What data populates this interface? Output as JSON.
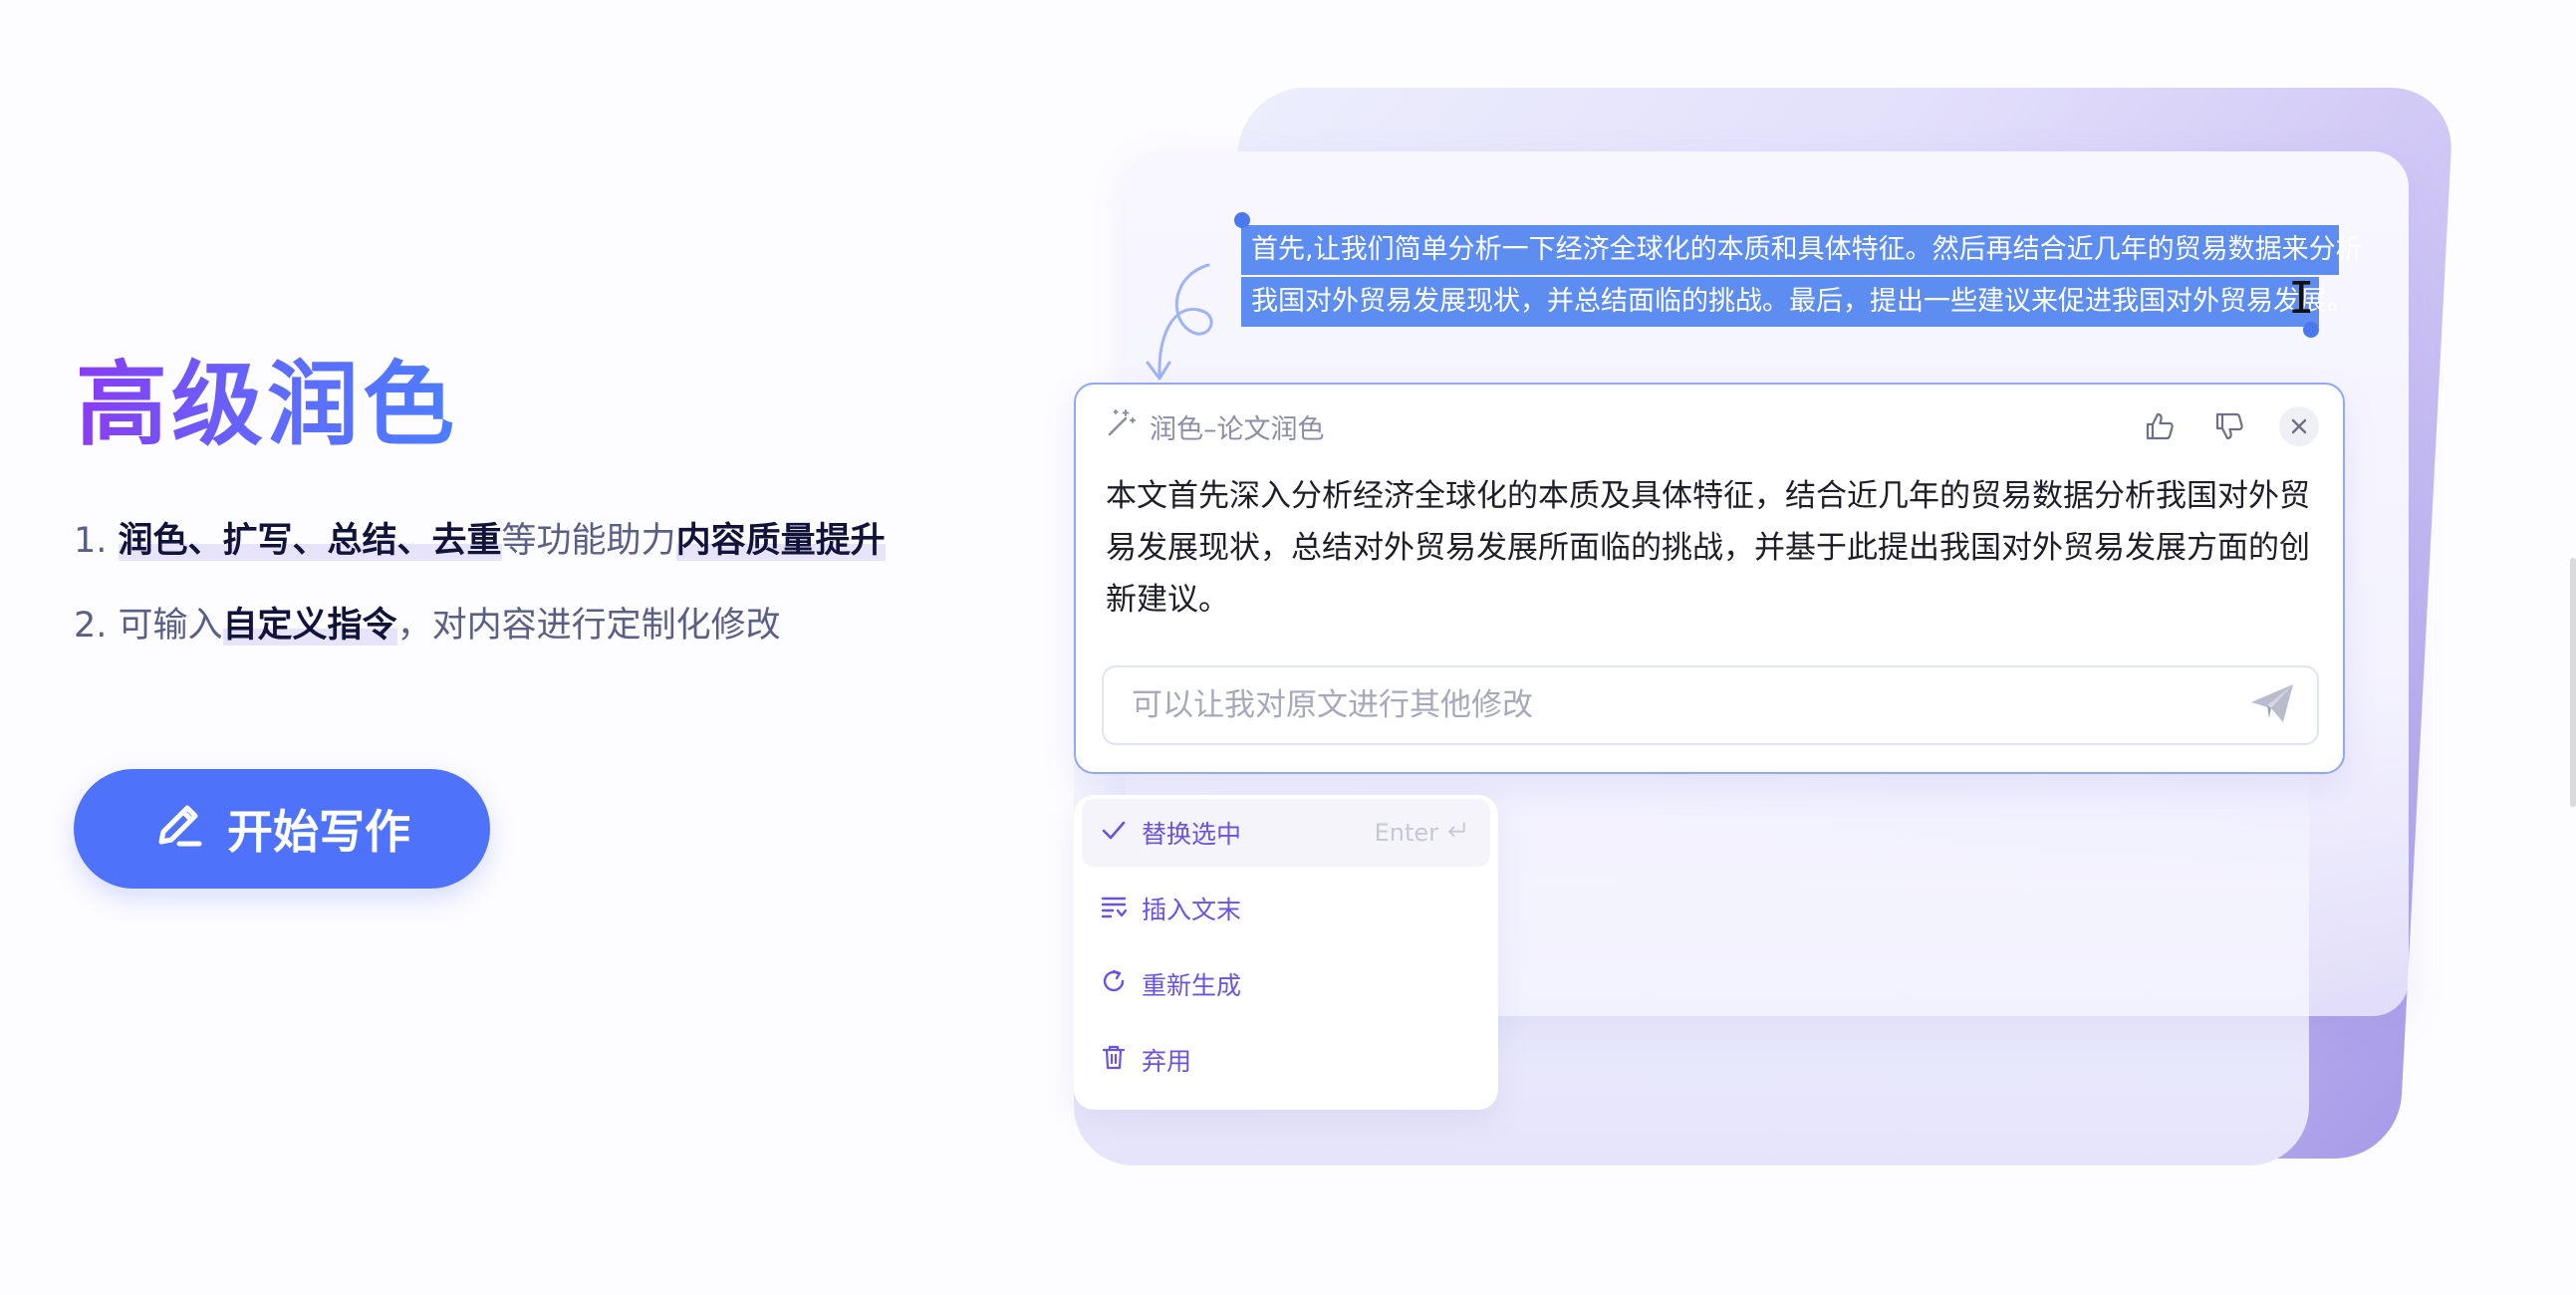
{
  "heading": "高级润色",
  "features": [
    {
      "index": "1. ",
      "parts": [
        {
          "text": "润色、扩写、总结、去重",
          "highlight": true
        },
        {
          "text": "等功能助力",
          "highlight": false
        },
        {
          "text": "内容质量提升",
          "highlight": true
        }
      ]
    },
    {
      "index": "2. ",
      "parts": [
        {
          "text": "可输入",
          "highlight": false
        },
        {
          "text": "自定义指令",
          "highlight": true
        },
        {
          "text": "，对内容进行定制化修改",
          "highlight": false
        }
      ]
    }
  ],
  "start_button": {
    "label": "开始写作",
    "icon": "pencil-icon",
    "color": "#4f72fb"
  },
  "selection_text": {
    "line1": "首先,让我们简单分析一下经济全球化的本质和具体特征。然后再结合近几年的贸易数据来分析",
    "line2": "我国对外贸易发展现状，并总结面临的挑战。最后，提出一些建议来促进我国对外贸易发展。",
    "highlight_color": "#5e8df1"
  },
  "dialog": {
    "title": "润色–论文润色",
    "title_icon": "magic-wand-icon",
    "actions": [
      "thumbs-up-icon",
      "thumbs-down-icon",
      "close-icon"
    ],
    "body": "本文首先深入分析经济全球化的本质及具体特征，结合近几年的贸易数据分析我国对外贸易发展现状，总结对外贸易发展所面临的挑战，并基于此提出我国对外贸易发展方面的创新建议。",
    "input_placeholder": "可以让我对原文进行其他修改",
    "send_icon": "send-icon",
    "border_color": "#90a8f7"
  },
  "menu": {
    "items": [
      {
        "label": "替换选中",
        "icon": "check-icon",
        "shortcut": "Enter",
        "shortcut_icon": "enter-key-icon",
        "active": true
      },
      {
        "label": "插入文末",
        "icon": "insert-lines-icon"
      },
      {
        "label": "重新生成",
        "icon": "refresh-icon"
      },
      {
        "label": "弃用",
        "icon": "trash-icon"
      }
    ],
    "accent_color": "#6a52e6"
  }
}
